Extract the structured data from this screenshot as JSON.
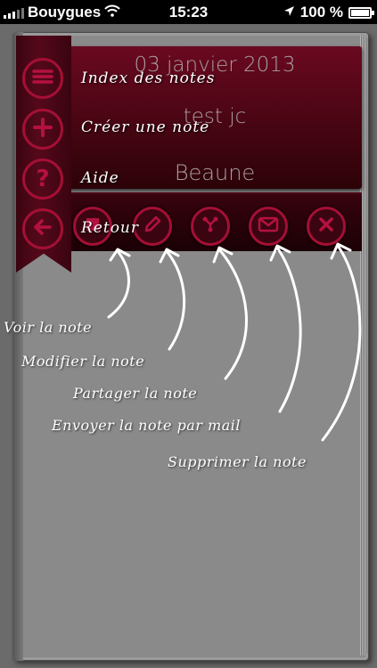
{
  "status_bar": {
    "carrier": "Bouygues",
    "time": "15:23",
    "battery": "100 %",
    "battery_level": 1.0
  },
  "note": {
    "date": "03 janvier 2013",
    "title": "test jc",
    "city": "Beaune"
  },
  "menu": {
    "items": [
      {
        "label": "Index des notes",
        "icon": "list-icon"
      },
      {
        "label": "Créer une note",
        "icon": "plus-icon"
      },
      {
        "label": "Aide",
        "icon": "help-icon"
      },
      {
        "label": "Retour",
        "icon": "back-arrow-icon"
      }
    ]
  },
  "toolbar": {
    "buttons": [
      {
        "icon": "view-icon"
      },
      {
        "icon": "pencil-icon"
      },
      {
        "icon": "share-icon"
      },
      {
        "icon": "mail-icon"
      },
      {
        "icon": "close-icon"
      }
    ]
  },
  "annotations": [
    "Voir la note",
    "Modifier la note",
    "Partager la note",
    "Envoyer la note par mail",
    "Supprimer la note"
  ],
  "colors": {
    "accent": "#a50f35",
    "card": "#4a0614",
    "background": "#6b6b6b"
  }
}
